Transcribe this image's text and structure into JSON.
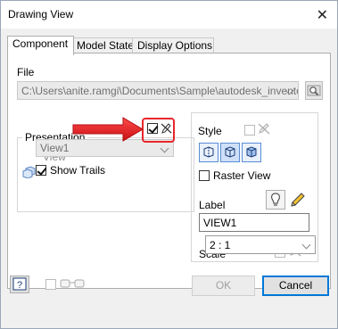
{
  "window": {
    "title": "Drawing View"
  },
  "tabs": [
    {
      "label": "Component"
    },
    {
      "label": "Model State"
    },
    {
      "label": "Display Options"
    }
  ],
  "file": {
    "label": "File",
    "path": "C:\\Users\\anite.ramgi\\Documents\\Sample\\autodesk_inventor"
  },
  "presentation": {
    "group_label": "Presentation",
    "view_label": "View",
    "view_value": "View1",
    "show_trails_label": "Show Trails"
  },
  "style": {
    "label": "Style",
    "raster_view_label": "Raster View"
  },
  "label_section": {
    "label": "Label",
    "value": "VIEW1"
  },
  "scale": {
    "label": "Scale",
    "value": "2 : 1"
  },
  "footer": {
    "ok_label": "OK",
    "cancel_label": "Cancel"
  },
  "colors": {
    "annotation_arrow": "#e8262b",
    "highlight": "#0078d7"
  }
}
